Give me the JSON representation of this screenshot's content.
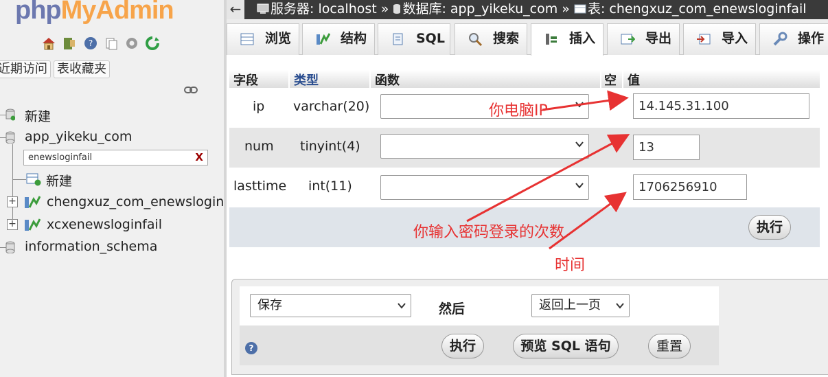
{
  "app": {
    "logo_php": "php",
    "logo_my": "MyAdmin"
  },
  "nav": {
    "tab_recent": "近期访问",
    "tab_favorites": "表收藏夹",
    "new_label": "新建",
    "databases": [
      {
        "name": "app_yikeku_com"
      },
      {
        "name": "information_schema"
      }
    ],
    "filter_value": "enewsloginfail",
    "filter_clear": "X",
    "sub_new_label": "新建",
    "tables": [
      {
        "name": "chengxuz_com_enewsloginfail"
      },
      {
        "name": "xcxenewsloginfail"
      }
    ]
  },
  "breadcrumb": {
    "server_label": "服务器: localhost",
    "db_label": "数据库: app_yikeku_com",
    "table_label": "表: chengxuz_com_enewsloginfail",
    "sep": "»"
  },
  "tabs": [
    {
      "label": "浏览"
    },
    {
      "label": "结构"
    },
    {
      "label": "SQL"
    },
    {
      "label": "搜索"
    },
    {
      "label": "插入"
    },
    {
      "label": "导出"
    },
    {
      "label": "导入"
    },
    {
      "label": "操作"
    }
  ],
  "insert": {
    "headers": {
      "field": "字段",
      "type": "类型",
      "function": "函数",
      "null": "空",
      "value": "值"
    },
    "rows": [
      {
        "field": "ip",
        "type": "varchar(20)",
        "function": "",
        "value": "14.145.31.100"
      },
      {
        "field": "num",
        "type": "tinyint(4)",
        "function": "",
        "value": "13"
      },
      {
        "field": "lasttime",
        "type": "int(11)",
        "function": "",
        "value": "1706256910"
      }
    ],
    "execute_label": "执行"
  },
  "footer_form": {
    "action_select": "保存",
    "then_label": "然后",
    "after_select": "返回上一页",
    "help_icon": "?",
    "execute_label": "执行",
    "preview_label": "预览 SQL 语句",
    "reset_label": "重置"
  },
  "annotations": {
    "ip_note": "你电脑IP",
    "num_note": "你输入密码登录的次数",
    "time_note": "时间",
    "color": "#e73232"
  },
  "colors": {
    "topbar": "#3a3a3a",
    "nav_bg": "#f0f0f0",
    "logo_blue": "#6c78af",
    "logo_orange": "#f7a44a"
  }
}
